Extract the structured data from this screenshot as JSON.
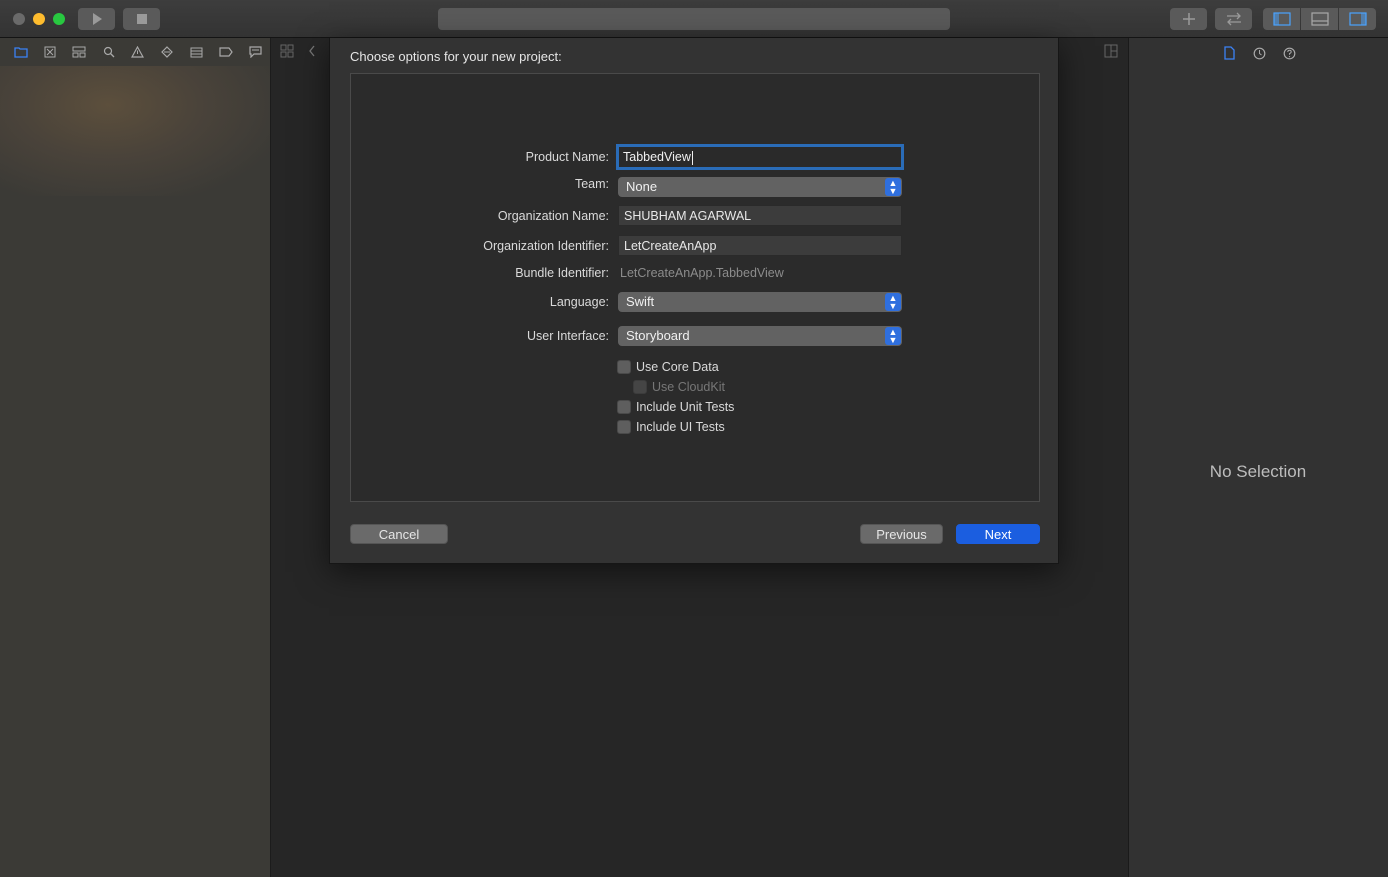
{
  "dialog": {
    "title": "Choose options for your new project:",
    "fields": {
      "product_name": {
        "label": "Product Name:",
        "value": "TabbedView"
      },
      "team": {
        "label": "Team:",
        "value": "None"
      },
      "organization_name": {
        "label": "Organization Name:",
        "value": "SHUBHAM AGARWAL"
      },
      "organization_identifier": {
        "label": "Organization Identifier:",
        "value": "LetCreateAnApp"
      },
      "bundle_identifier": {
        "label": "Bundle Identifier:",
        "value": "LetCreateAnApp.TabbedView"
      },
      "language": {
        "label": "Language:",
        "value": "Swift"
      },
      "user_interface": {
        "label": "User Interface:",
        "value": "Storyboard"
      }
    },
    "checkboxes": {
      "use_core_data": {
        "label": "Use Core Data",
        "checked": false
      },
      "use_cloudkit": {
        "label": "Use CloudKit",
        "checked": false,
        "enabled": false
      },
      "include_unit_tests": {
        "label": "Include Unit Tests",
        "checked": false
      },
      "include_ui_tests": {
        "label": "Include UI Tests",
        "checked": false
      }
    },
    "buttons": {
      "cancel": "Cancel",
      "previous": "Previous",
      "next": "Next"
    }
  },
  "inspector": {
    "empty_state": "No Selection"
  },
  "colors": {
    "accent": "#1b5ee0",
    "focus_ring": "#2a6cb8",
    "traffic_close": "#6a6a6a",
    "traffic_minimize": "#febc2e",
    "traffic_maximize": "#28c840"
  },
  "icons": {
    "navigator": [
      "folder-icon",
      "source-control-icon",
      "symbol-icon",
      "search-icon",
      "warning-icon",
      "test-icon",
      "debug-icon",
      "breakpoint-icon",
      "report-icon"
    ],
    "inspector": [
      "file-inspector-icon",
      "history-icon",
      "help-icon"
    ],
    "toolbar": [
      "run-icon",
      "stop-icon",
      "add-icon",
      "swap-icon",
      "left-panel-icon",
      "bottom-panel-icon",
      "right-panel-icon"
    ]
  }
}
